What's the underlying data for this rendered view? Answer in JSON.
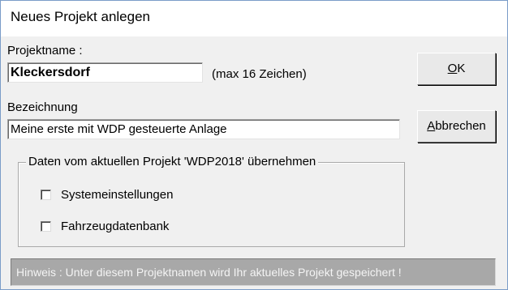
{
  "window": {
    "title": "Neues Projekt anlegen"
  },
  "projektname": {
    "label": "Projektname :",
    "value": "Kleckersdorf",
    "hint": "(max 16 Zeichen)"
  },
  "bezeichnung": {
    "label": "Bezeichnung",
    "value": "Meine erste mit WDP gesteuerte Anlage"
  },
  "buttons": {
    "ok_accel": "O",
    "ok_rest": "K",
    "cancel_accel": "A",
    "cancel_rest": "bbrechen"
  },
  "group": {
    "title": "Daten vom aktuellen Projekt 'WDP2018' übernehmen",
    "options": [
      {
        "label": "Systemeinstellungen",
        "checked": false
      },
      {
        "label": "Fahrzeugdatenbank",
        "checked": false
      }
    ]
  },
  "status": {
    "hint": "Hinweis : Unter diesem Projektnamen wird Ihr aktuelles  Projekt gespeichert !"
  }
}
